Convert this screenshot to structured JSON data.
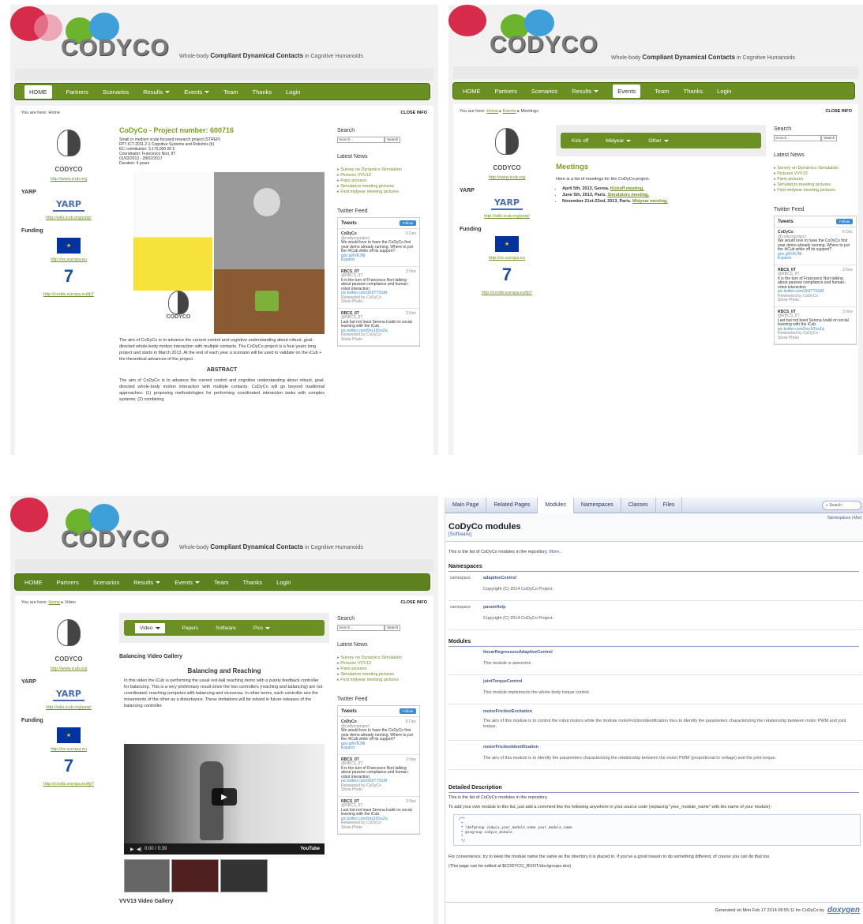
{
  "site": {
    "logo": "CODYCO",
    "tagline_pre": "Whole-body",
    "tagline_main": "Compliant Dynamical Contacts",
    "tagline_post": "in Cognitive Humanoids",
    "close_info": "CLOSE INFO",
    "nav": {
      "home": "HOME",
      "partners": "Partners",
      "scenarios": "Scenarios",
      "results": "Results",
      "events": "Events",
      "team": "Team",
      "thanks": "Thanks",
      "login": "Login"
    },
    "sidebar": {
      "icub_brand": "CODYCO",
      "icub_link": "http://www.icub.org",
      "yarp_heading": "YARP",
      "yarp_logo": "YARP",
      "yarp_link": "http://wiki.icub.org/yarp/",
      "funding_heading": "Funding",
      "ec_link": "http://ec.europa.eu",
      "fp7_logo": "7",
      "fp7_link": "http://cordis.europa.eu/fp7"
    },
    "right": {
      "search_heading": "Search",
      "search_placeholder": "Search...",
      "search_button": "Search",
      "news_heading": "Latest News",
      "news": [
        "Survey on Dynamics Simulation",
        "Pictures VVV13",
        "Paris pictures",
        "Simulators meeting pictures",
        "First midyear meeting pictures"
      ],
      "twitter_heading": "Twitter Feed",
      "tweets_label": "Tweets",
      "follow": "Follow",
      "tweets": [
        {
          "name": "CoDyCo",
          "user": "@codycoproject",
          "date": "6 Dec",
          "text": "We would love to have the CoDyCo first year demo already running. Where to put the #iCub while off its support?",
          "link": "goo.gl/IVKJNI",
          "extra": "Expand"
        },
        {
          "name": "RBCS_IIT",
          "user": "@RBCS_IIT",
          "date": "3 Nov",
          "text": "It is the turn of Francesco Nori talking about passive compliance and human-robot interaction",
          "link": "pic.twitter.com/Zk9TT5SAf",
          "extra": "Retweeted by CoDyCo",
          "photo": "Show Photo"
        },
        {
          "name": "RBCS_IIT",
          "user": "@RBCS_IIT",
          "date": "3 Nov",
          "text": "Last but not least Serena Ivaldi on social learning with the iCub.",
          "link": "pic.twitter.com/5xx1tTosZq",
          "extra": "Retweeted by CoDyCo",
          "photo": "Show Photo"
        }
      ]
    }
  },
  "page1": {
    "crumb_label": "You are here:",
    "crumb_home": "Home",
    "title": "CoDyCo - Project number: 600716",
    "meta": [
      "Small or medium scale focused research project (STREP)",
      "FP7-ICT-2011.2.1 Cognitive Systems and Robotics (b)",
      "EC contribution: 3,175,000.00 €",
      "Coordinator: Francesco Nori, IIT",
      "01/03/2013 - 28/02/2017",
      "Duration: 4 years"
    ],
    "intro": "The aim of CoDyCo is to advance the current control and cognitive understanding about robust, goal- directed whole-body motion interaction with multiple contacts. The CoDyCo project is a four-years long project and starts in March 2013. At the end of each year a scenario will be used to validate on the iCub + the theoretical advances of the project.",
    "abstract_heading": "ABSTRACT",
    "abstract": "The aim of CoDyCo is to advance the current control and cognitive understanding about robust, goal- directed whole-body motion interaction with multiple contacts. CoDyCo will go beyond traditional approaches: (1) proposing methodologies for performing coordinated interaction tasks with complex systems; (2) combining"
  },
  "page2": {
    "crumb_label": "You are here:",
    "crumb_home": "Home",
    "crumb_events": "Events",
    "crumb_current": "Meetings",
    "tabs": {
      "kickoff": "Kick off",
      "midyear": "Midyear",
      "other": "Other"
    },
    "title": "Meetings",
    "intro": "Here is a list of meetings for the CoDyCo project.",
    "items": [
      {
        "text": "April 5th, 2013, Genoa.",
        "link": "Kickoff meeting."
      },
      {
        "text": "June 5th, 2013, Paris.",
        "link": "Simulators meeting."
      },
      {
        "text": "November 21st-22nd, 2013, Paris.",
        "link": "Midyear meeting."
      }
    ]
  },
  "page3": {
    "crumb_label": "You are here:",
    "crumb_home": "Home",
    "crumb_current": "Video",
    "tabs": {
      "video": "Video",
      "papers": "Papers",
      "software": "Software",
      "pics": "Pics"
    },
    "gallery_title": "Balancing Video Gallery",
    "video_heading": "Balancing and Reaching",
    "text": "In this video the iCub is performing the usual red-ball reaching demo with a purely feedback controller for balancing. This is a very preliminary result since the two controllers (reaching and balancing) are not coordinated: reaching competes with balancing and viceversa. In other terms, each controller see the movements of the other as a disturbance. These limitations will be solved in future releases of the balancing controller.",
    "time": "0:00 / 0:39",
    "yt": "YouTube",
    "next_gallery": "VVV13 Video Gallery"
  },
  "page4": {
    "tabs": [
      "Main Page",
      "Related Pages",
      "Modules",
      "Namespaces",
      "Classes",
      "Files"
    ],
    "search": "Search",
    "links": "Namespaces | Mod",
    "title": "CoDyCo modules",
    "subtitle": "[Software]",
    "intro": "This is the list of CoDyCo modules in the repository.",
    "more": "More...",
    "ns_heading": "Namespaces",
    "namespaces": [
      {
        "kind": "namespace",
        "name": "adaptiveControl",
        "desc": "Copyright (C) 2014 CoDyCo Project."
      },
      {
        "kind": "namespace",
        "name": "paramHelp",
        "desc": "Copyright (C) 2014 CoDyCo Project."
      }
    ],
    "mod_heading": "Modules",
    "modules": [
      {
        "name": "linearRegressorsAdaptiveControl",
        "desc": "This module is awesome."
      },
      {
        "name": "jointTorqueControl",
        "desc": "This module implements the whole-body torque control."
      },
      {
        "name": "motorFrictionExcitation",
        "desc": "The aim of this module is to control the robot motors while the module motorFrictionIdentification tries to identify the parameters characterizing the relationship between motor PWM and joint torque."
      },
      {
        "name": "motorFrictionIdentification",
        "desc": "The aim of this module is to identify the parameters characterizing the relationship between the motor PWM (proportional to voltage) and the joint torque."
      }
    ],
    "detail_heading": "Detailed Description",
    "detail1": "This is the list of CoDyCo modules in the repository.",
    "detail2": "To add your own module to this list, just add a comment like the following anywhere in your source code (replacing \"your_module_name\" with the name of your module):",
    "code": "/**\n *\n * \\defgroup codyco_your_module_name your_module_name\n * @ingroup codyco_module\n *\n */",
    "detail3": "For convenience, try to keep the module name the same as the directory it is placed in. If you've a good reason to do something different, of course you can do that too.",
    "detail4": "(This page can be edited at $CODYCO_ROOT/doc/groups.dox)",
    "footer": "Generated on Mon Feb 17 2014 08:55:11 for CoDyCo by",
    "doxygen": "doxygen"
  }
}
